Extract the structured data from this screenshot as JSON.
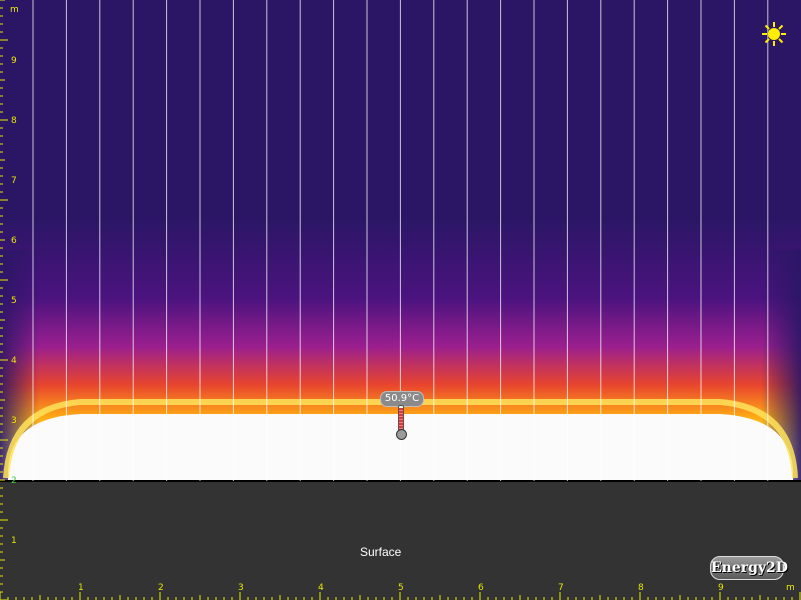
{
  "app": {
    "logo_text": "Energy2D"
  },
  "simulation": {
    "surface_label": "Surface",
    "sun_icon": "sun-icon",
    "colors": {
      "background_cold": "#2a1665",
      "ground": "#333333",
      "ruler_tick": "#e8e800",
      "ruler_label_green": "#3ad13a",
      "sunlight_ray": "#ffffff"
    }
  },
  "thermometer": {
    "reading": "50.9°C"
  },
  "ruler": {
    "unit_label": "m",
    "x_labels": [
      "1",
      "2",
      "3",
      "4",
      "5",
      "6",
      "7",
      "8",
      "9"
    ],
    "y_labels": [
      "1",
      "2",
      "3",
      "4",
      "5",
      "6",
      "7",
      "8",
      "9"
    ]
  }
}
